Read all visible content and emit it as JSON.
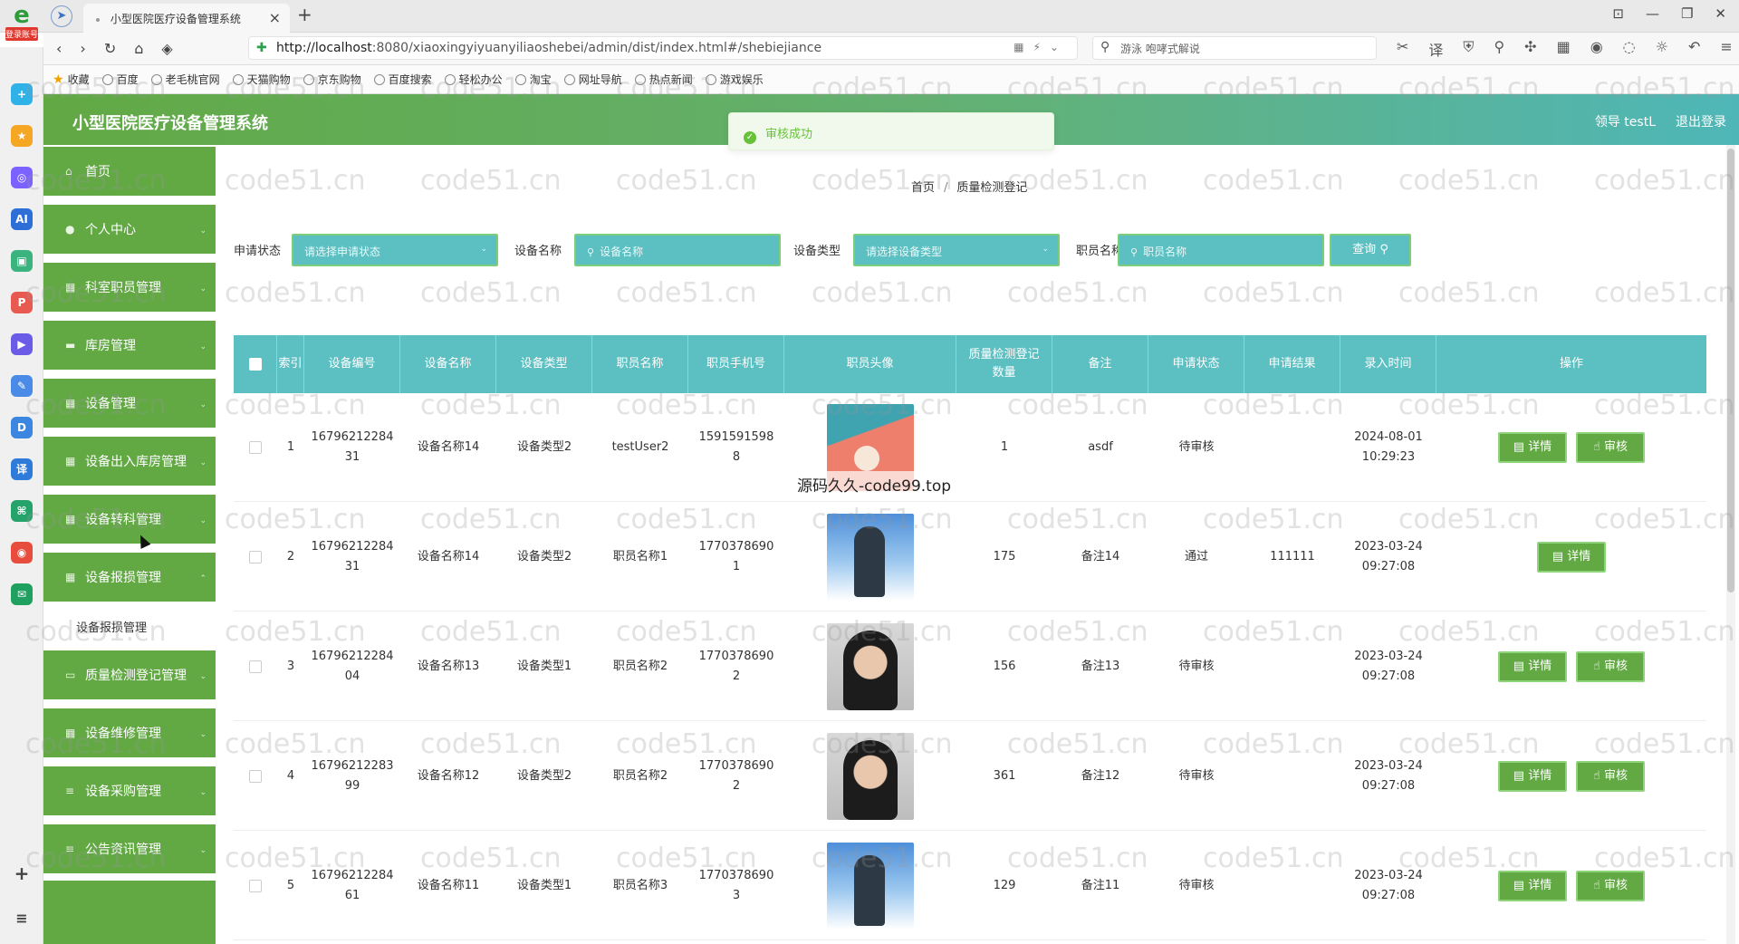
{
  "browser": {
    "logo_text": "e",
    "logo_tag": "登录账号",
    "tab_title": "小型医院医疗设备管理系统",
    "tab_close": "×",
    "new_tab": "+",
    "url_host": "http://localhost",
    "url_rest": ":8080/xiaoxingyiyuanyiliaoshebei/admin/dist/index.html#/shebiejiance",
    "search_text": "游泳 咆哮式解说",
    "bookmarks": [
      "收藏",
      "百度",
      "老毛桃官网",
      "天猫购物",
      "京东购物",
      "百度搜索",
      "轻松办公",
      "淘宝",
      "网址导航",
      "热点新闻",
      "游戏娱乐"
    ]
  },
  "app": {
    "title": "小型医院医疗设备管理系统",
    "user_label": "领导 testL",
    "logout_label": "退出登录"
  },
  "sidebar": {
    "items": [
      {
        "label": "首页",
        "icon": "home-icon"
      },
      {
        "label": "个人中心",
        "icon": "user-icon"
      },
      {
        "label": "科室职员管理",
        "icon": "grid-icon"
      },
      {
        "label": "库房管理",
        "icon": "warehouse-icon"
      },
      {
        "label": "设备管理",
        "icon": "grid-icon"
      },
      {
        "label": "设备出入库房管理",
        "icon": "grid-icon"
      },
      {
        "label": "设备转科管理",
        "icon": "grid-icon"
      },
      {
        "label": "设备报损管理",
        "icon": "grid-icon"
      },
      {
        "label": "质量检测登记管理",
        "icon": "monitor-icon"
      },
      {
        "label": "设备维修管理",
        "icon": "grid-icon"
      },
      {
        "label": "设备采购管理",
        "icon": "list-icon"
      },
      {
        "label": "公告资讯管理",
        "icon": "list-icon"
      }
    ],
    "submenu_label": "设备报损管理"
  },
  "toast": {
    "message": "审核成功"
  },
  "breadcrumb": {
    "home": "首页",
    "separator": "/",
    "current": "质量检测登记"
  },
  "search": {
    "status_label": "申请状态",
    "status_placeholder": "请选择申请状态",
    "device_name_label": "设备名称",
    "device_name_placeholder": "设备名称",
    "device_type_label": "设备类型",
    "device_type_placeholder": "请选择设备类型",
    "staff_name_label": "职员名称",
    "staff_name_placeholder": "职员名称",
    "query_label": "查询"
  },
  "table": {
    "headers": [
      "索引",
      "设备编号",
      "设备名称",
      "设备类型",
      "职员名称",
      "职员手机号",
      "职员头像",
      "质量检测登记\n数量",
      "备注",
      "申请状态",
      "申请结果",
      "录入时间",
      "操作"
    ],
    "detail_label": "详情",
    "audit_label": "审核",
    "rows": [
      {
        "index": "1",
        "code": "16796212284\n31",
        "name": "设备名称14",
        "type": "设备类型2",
        "staff": "testUser2",
        "phone": "1591591598\n8",
        "avatar": "a",
        "count": "1",
        "note": "asdf",
        "status": "待审核",
        "result": "",
        "time": "2024-08-01\n10:29:23",
        "can_audit": true
      },
      {
        "index": "2",
        "code": "16796212284\n31",
        "name": "设备名称14",
        "type": "设备类型2",
        "staff": "职员名称1",
        "phone": "1770378690\n1",
        "avatar": "b",
        "count": "175",
        "note": "备注14",
        "status": "通过",
        "result": "111111",
        "time": "2023-03-24\n09:27:08",
        "can_audit": false
      },
      {
        "index": "3",
        "code": "16796212284\n04",
        "name": "设备名称13",
        "type": "设备类型1",
        "staff": "职员名称2",
        "phone": "1770378690\n2",
        "avatar": "c",
        "count": "156",
        "note": "备注13",
        "status": "待审核",
        "result": "",
        "time": "2023-03-24\n09:27:08",
        "can_audit": true
      },
      {
        "index": "4",
        "code": "16796212283\n99",
        "name": "设备名称12",
        "type": "设备类型2",
        "staff": "职员名称2",
        "phone": "1770378690\n2",
        "avatar": "c",
        "count": "361",
        "note": "备注12",
        "status": "待审核",
        "result": "",
        "time": "2023-03-24\n09:27:08",
        "can_audit": true
      },
      {
        "index": "5",
        "code": "16796212284\n61",
        "name": "设备名称11",
        "type": "设备类型1",
        "staff": "职员名称3",
        "phone": "1770378690\n3",
        "avatar": "b",
        "count": "129",
        "note": "备注11",
        "status": "待审核",
        "result": "",
        "time": "2023-03-24\n09:27:08",
        "can_audit": true
      }
    ]
  },
  "watermark": {
    "text": "code51.cn",
    "overlay": "源码久久-code99.top"
  },
  "colors": {
    "green": "#62a944",
    "teal": "#5cbfc2",
    "success": "#67c23a"
  }
}
